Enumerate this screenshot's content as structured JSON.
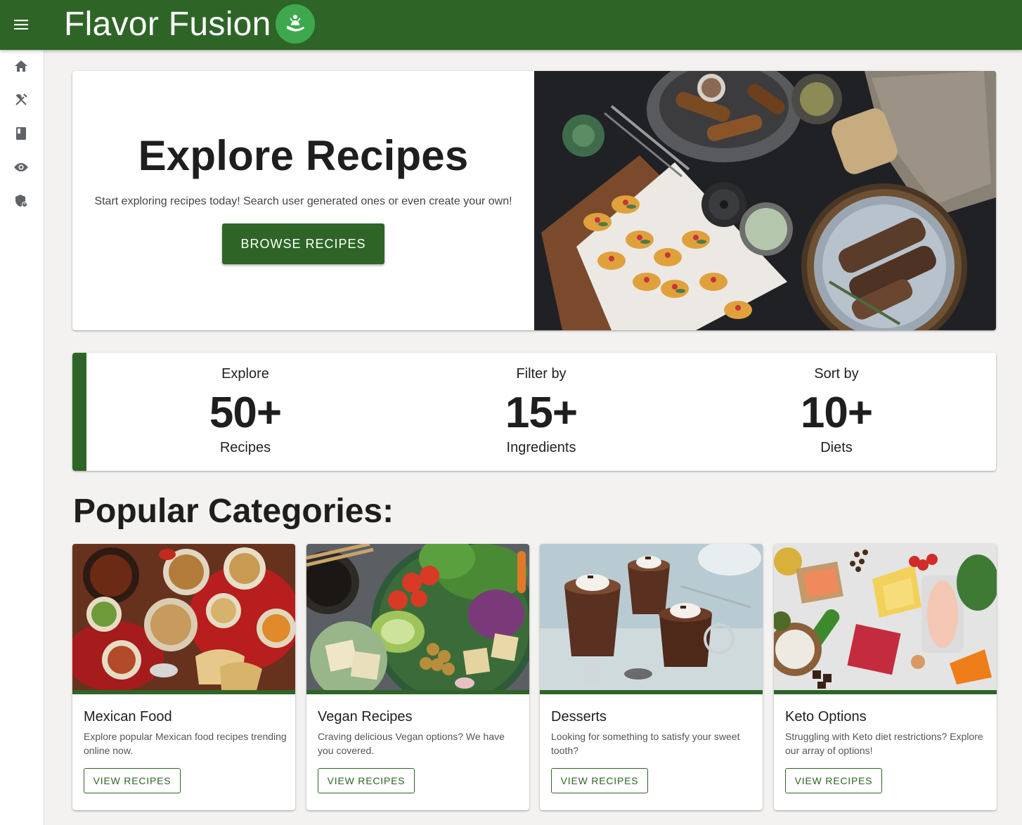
{
  "app": {
    "title": "Flavor Fusion",
    "brand_color": "#2e6527",
    "logo_color": "#3fa84e"
  },
  "sidebar": {
    "items": [
      {
        "icon": "home-icon"
      },
      {
        "icon": "utensils-icon"
      },
      {
        "icon": "book-icon"
      },
      {
        "icon": "eye-icon"
      },
      {
        "icon": "shield-icon"
      }
    ]
  },
  "hero": {
    "title": "Explore Recipes",
    "subtitle": "Start exploring recipes today! Search user generated ones or even create your own!",
    "button_label": "BROWSE RECIPES"
  },
  "stats": [
    {
      "top": "Explore",
      "number": "50+",
      "bottom": "Recipes"
    },
    {
      "top": "Filter by",
      "number": "15+",
      "bottom": "Ingredients"
    },
    {
      "top": "Sort by",
      "number": "10+",
      "bottom": "Diets"
    }
  ],
  "categories": {
    "heading": "Popular Categories:",
    "items": [
      {
        "title": "Mexican Food",
        "description": "Explore popular Mexican food recipes trending online now.",
        "button_label": "VIEW RECIPES"
      },
      {
        "title": "Vegan Recipes",
        "description": "Craving delicious Vegan options? We have you covered.",
        "button_label": "VIEW RECIPES"
      },
      {
        "title": "Desserts",
        "description": "Looking for something to satisfy your sweet tooth?",
        "button_label": "VIEW RECIPES"
      },
      {
        "title": "Keto Options",
        "description": "Struggling with Keto diet restrictions? Explore our array of options!",
        "button_label": "VIEW RECIPES"
      }
    ]
  }
}
